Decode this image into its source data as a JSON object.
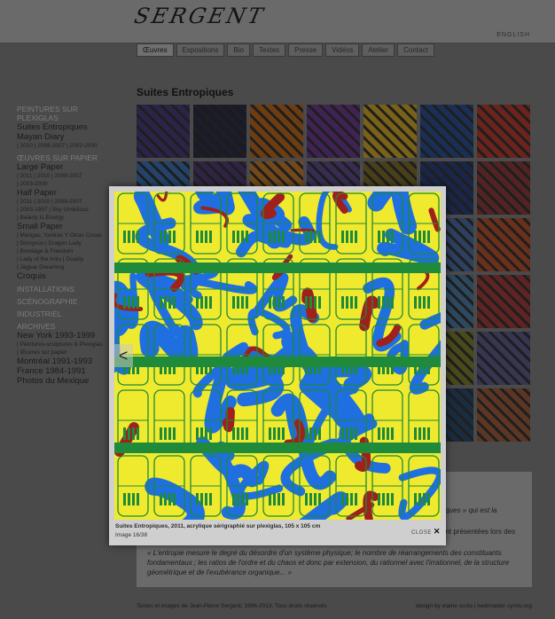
{
  "brand": {
    "logo": "SERGENT",
    "lang_link": "ENGLISH"
  },
  "nav": {
    "tabs": [
      "Œuvres",
      "Expositions",
      "Bio",
      "Textes",
      "Presse",
      "Vidéos",
      "Atelier",
      "Contact"
    ],
    "active": 0
  },
  "page_title": "Suites Entropiques",
  "sidebar": [
    {
      "cat": "PEINTURES SUR PLEXIGLAS",
      "items": [
        {
          "label": "Suites Entropiques",
          "subs": []
        },
        {
          "label": "Mayan Diary",
          "subs": [
            "| 2010 | 2008-2007 | 2002-2000"
          ]
        }
      ]
    },
    {
      "cat": "ŒUVRES SUR PAPIER",
      "items": [
        {
          "label": "Large Paper",
          "subs": [
            "| 2011 | 2010 | 2008-2007",
            "| 2003-2000"
          ]
        },
        {
          "label": "Half Paper",
          "subs": [
            "| 2011 | 2010 | 2009-2007",
            "| 2003-1997 | Sky Umbilicus",
            "| Beauty Is Energy"
          ]
        },
        {
          "label": "Small Paper",
          "subs": [
            "| Mangas, Yantras Y Otras Cosas",
            "| Dionysos | Dragon Lady",
            "| Bondage & Freedom",
            "| Lady of the Ants | Duality",
            "| Jaguar Dreaming"
          ]
        },
        {
          "label": "Croquis",
          "subs": []
        }
      ]
    },
    {
      "cat": "INSTALLATIONS",
      "items": []
    },
    {
      "cat": "SCÉNOGRAPHIE",
      "items": []
    },
    {
      "cat": "INDUSTRIEL",
      "items": []
    },
    {
      "cat": "ARCHIVES",
      "items": [
        {
          "label": "New York 1993-1999",
          "subs": [
            "| Peintures-sculptures & Plexiglas",
            "| Œuvres sur papier"
          ]
        },
        {
          "label": "Montréal 1991-1993",
          "subs": []
        },
        {
          "label": "France 1984-1991",
          "subs": []
        },
        {
          "label": "Photos du Mexique",
          "subs": []
        }
      ]
    }
  ],
  "thumbnails": [
    "#4a3b7a",
    "#2c2c44",
    "#b5651d",
    "#6b3a8c",
    "#c9a227",
    "#2a4f8f",
    "#b23a2e",
    "#3a6fb0",
    "#4f3c72",
    "#c07a2a",
    "#5d4a8a",
    "#7a6a2a",
    "#2c3f7a",
    "#8a3a3a",
    "#5a4aa0",
    "#8a5a2a",
    "#3a3a6a",
    "#6a6a8a",
    "#a07a2a",
    "#4a6aa0",
    "#b2502e",
    "#2a5a8a",
    "#6a3a7a",
    "#9a6a2a",
    "#3a4a7a",
    "#7a5a2a",
    "#4a7aa0",
    "#a03a3a",
    "#3a3a5a",
    "#8a6a3a",
    "#5a3a6a",
    "#6a7a3a",
    "#3a5a7a",
    "#7a7a2a",
    "#5a5a8a",
    "#4a4a6a",
    "#6a4a3a",
    "#3a6a6a",
    "#8a4a6a",
    "#5a6a3a",
    "#2a4a6a",
    "#9a5a3a"
  ],
  "text": {
    "frag1": "piques » qui est la",
    "frag2": "ont présentées lors des",
    "quote": "« L'entropie mesure le degré du désordre d'un système physique; le nombre de réarrangements des constituants fondamentaux ; les ratios de l'ordre et du chaos et donc par extension, du rationnel avec l'irrationnel, de la structure géométrique et de l'exubérance organique... »"
  },
  "footer": {
    "left": "Textes et images de Jean-Pierre Sergent, 1996-2013. Tous droits réservés.",
    "right": "design by elaine scola | webmaster cyrclo.org"
  },
  "lightbox": {
    "caption": "Suites Entropiques, 2011, acrylique sérigraphié sur plexiglas, 105 x 105 cm",
    "counter": "Image 16/38",
    "close_label": "CLOSE",
    "close_glyph": "✕",
    "prev_glyph": "<",
    "colors": {
      "yellow": "#f0ea2e",
      "blue": "#1f6fe0",
      "red": "#a0201c",
      "green": "#1e8a3a"
    }
  }
}
